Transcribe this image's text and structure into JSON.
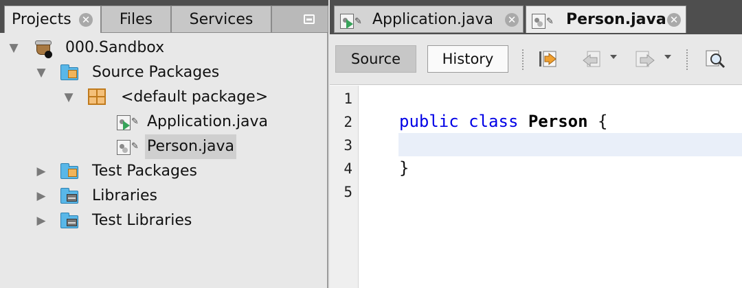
{
  "left_panel": {
    "tabs": [
      {
        "label": "Projects",
        "active": true
      },
      {
        "label": "Files",
        "active": false
      },
      {
        "label": "Services",
        "active": false
      }
    ],
    "tree": [
      {
        "label": "000.Sandbox",
        "icon": "project-icon",
        "expanded": true
      },
      {
        "label": "Source Packages",
        "icon": "source-packages-icon",
        "expanded": true
      },
      {
        "label": "<default package>",
        "icon": "package-icon",
        "expanded": true
      },
      {
        "label": "Application.java",
        "icon": "java-main-file-icon"
      },
      {
        "label": "Person.java",
        "icon": "java-file-icon",
        "selected": true
      },
      {
        "label": "Test Packages",
        "icon": "test-packages-icon",
        "expanded": false
      },
      {
        "label": "Libraries",
        "icon": "libraries-icon",
        "expanded": false
      },
      {
        "label": "Test Libraries",
        "icon": "test-libraries-icon",
        "expanded": false
      }
    ]
  },
  "editor": {
    "tabs": [
      {
        "label": "Application.java",
        "active": false
      },
      {
        "label": "Person.java",
        "active": true
      }
    ],
    "toolbar": {
      "source_label": "Source",
      "history_label": "History",
      "icons": [
        "last-edit-icon",
        "back-icon",
        "forward-icon",
        "find-icon"
      ]
    },
    "line_numbers": [
      "1",
      "2",
      "3",
      "4",
      "5"
    ],
    "code": {
      "kw_public": "public",
      "kw_class": "class",
      "class_name": "Person",
      "open_brace": "{",
      "close_brace": "}"
    }
  },
  "colors": {
    "keyword": "#0000e6",
    "current_line": "#e9eff9",
    "tab_bar": "#4e4e4e",
    "selection": "#cfcfcf"
  }
}
